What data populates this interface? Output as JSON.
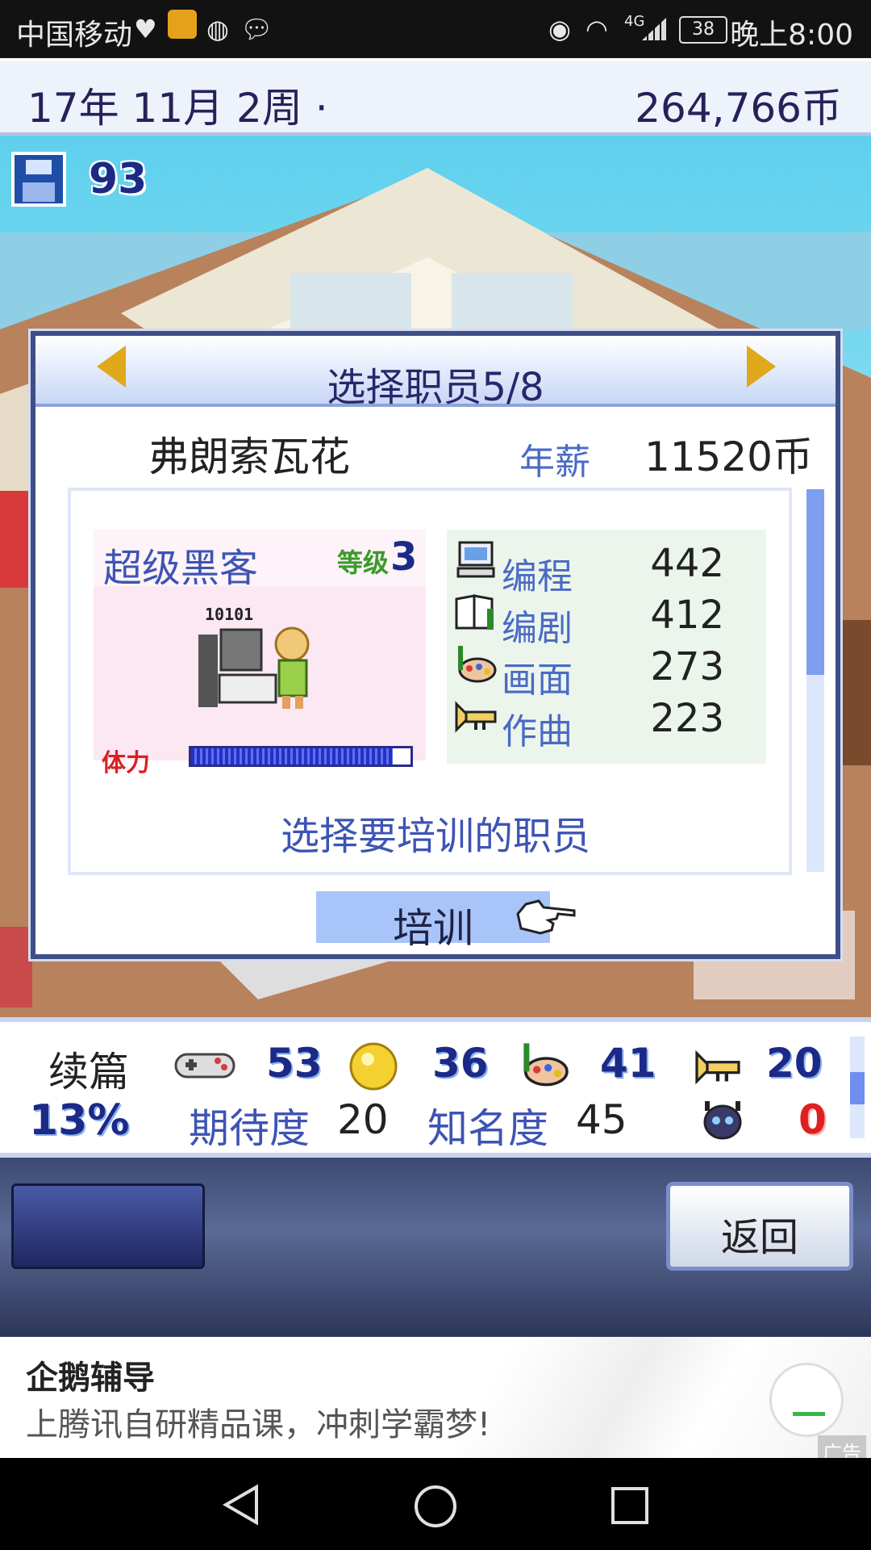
{
  "status_bar": {
    "carrier": "中国移动",
    "battery": "38",
    "network": "4G",
    "time": "晚上8:00"
  },
  "header": {
    "date": "17年 11月 2周 ·",
    "money": "264,766币"
  },
  "save_count": "93",
  "dialog": {
    "title": "选择职员5/8",
    "employee_name": "弗朗索瓦花",
    "salary_label": "年薪",
    "salary_value": "11520币",
    "job_title": "超级黑客",
    "level_label": "等级",
    "level_value": "3",
    "sprite_caption": "10101",
    "hp_label": "体力",
    "hp_fraction": 0.92,
    "stats": [
      {
        "label": "编程",
        "value": "442",
        "icon": "computer-icon"
      },
      {
        "label": "编剧",
        "value": "412",
        "icon": "book-icon"
      },
      {
        "label": "画面",
        "value": "273",
        "icon": "palette-icon"
      },
      {
        "label": "作曲",
        "value": "223",
        "icon": "trumpet-icon"
      }
    ],
    "prompt": "选择要培训的职员",
    "train_button": "培训"
  },
  "info_panel": {
    "sequel_label": "续篇",
    "stat_values": [
      "53",
      "36",
      "41",
      "20"
    ],
    "stat_icons": [
      "gamepad-icon",
      "coin-icon",
      "palette-icon",
      "trumpet-icon"
    ],
    "percent": "13%",
    "expectation_label": "期待度",
    "expectation_value": "20",
    "fame_label": "知名度",
    "fame_value": "45",
    "bug_value": "0"
  },
  "back_button": "返回",
  "ad": {
    "title": "企鹅辅导",
    "text": "上腾讯自研精品课，冲刺学霸梦!",
    "badge": "广告"
  },
  "colors": {
    "dialog_border": "#3e4e86",
    "accent_blue": "#3d54b4",
    "button_highlight": "#a8c4f8",
    "arrow_gold": "#e0a81a"
  }
}
